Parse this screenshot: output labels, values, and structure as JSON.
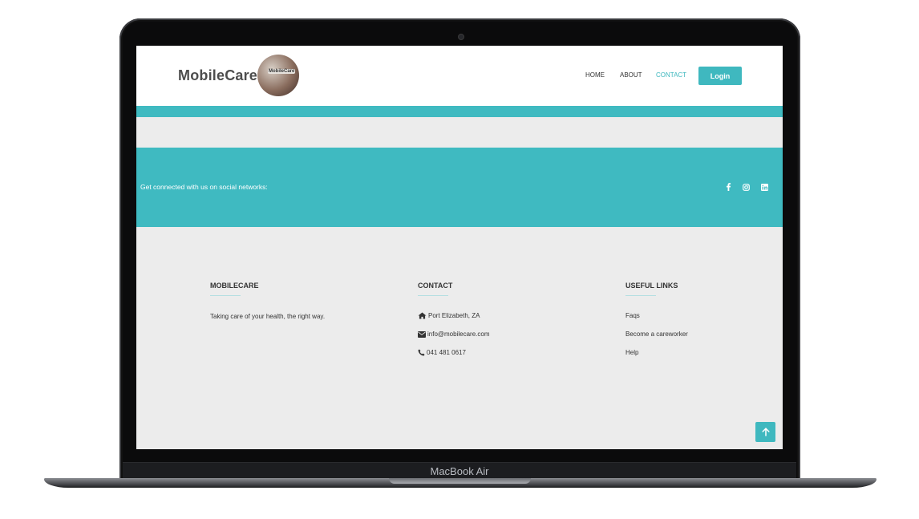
{
  "device": {
    "label": "MacBook Air"
  },
  "navbar": {
    "brand": "MobileCare",
    "logo_text": "MobileCare",
    "links": [
      {
        "label": "HOME"
      },
      {
        "label": "ABOUT"
      },
      {
        "label": "CONTACT",
        "active": true
      }
    ],
    "login_label": "Login"
  },
  "social": {
    "text": "Get connected with us on social networks:",
    "icons": [
      "facebook-icon",
      "instagram-icon",
      "linkedin-icon"
    ]
  },
  "footer": {
    "about": {
      "heading": "MOBILECARE",
      "text": "Taking care of your health, the right way."
    },
    "contact": {
      "heading": "CONTACT",
      "address": "Port Elizabeth, ZA",
      "email": "info@mobilecare.com",
      "phone": "041 481 0617"
    },
    "links": {
      "heading": "USEFUL LINKS",
      "items": [
        "Faqs",
        "Become a careworker",
        "Help"
      ]
    }
  },
  "colors": {
    "accent": "#3fb8bf",
    "page_bg": "#ececec",
    "frame": "#0b0b0c"
  }
}
